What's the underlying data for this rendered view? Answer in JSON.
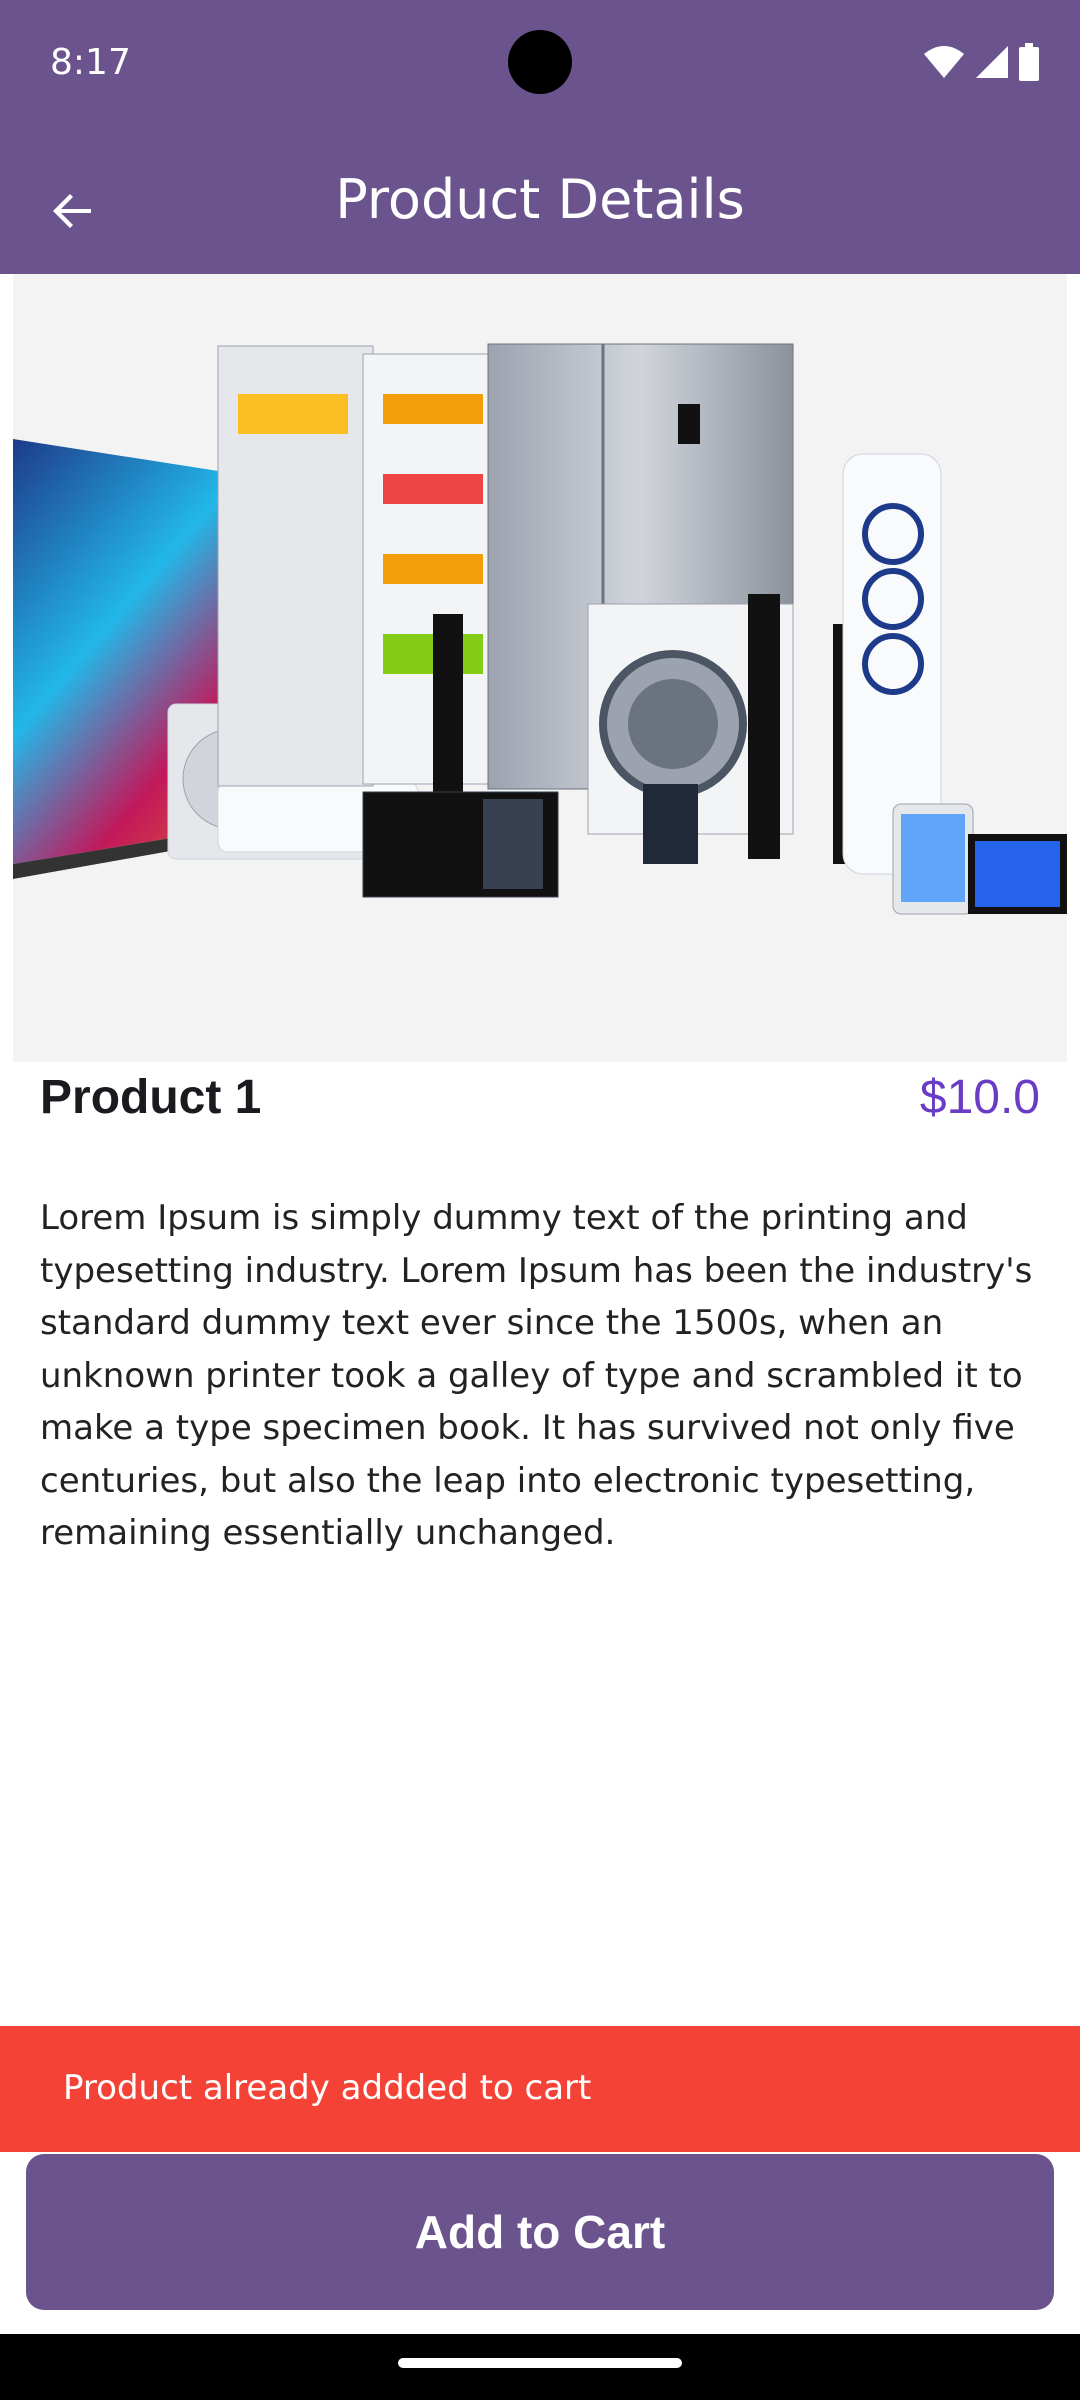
{
  "status_bar": {
    "time": "8:17",
    "icons": [
      "wifi-icon",
      "signal-icon",
      "battery-icon"
    ]
  },
  "app_bar": {
    "title": "Product Details",
    "back_icon": "arrow-back-icon"
  },
  "product": {
    "name": "Product 1",
    "price": "$10.0",
    "description": "Lorem Ipsum is simply dummy text of the printing and typesetting industry. Lorem Ipsum has been the industry's standard dummy text ever since the 1500s, when an unknown printer took a galley of type and scrambled it to make a type specimen book. It has survived not only five centuries, but also the leap into electronic typesetting, remaining essentially unchanged."
  },
  "snackbar": {
    "message": "Product already addded to cart"
  },
  "actions": {
    "add_to_cart_label": "Add to Cart"
  },
  "colors": {
    "primary": "#6b548e",
    "price": "#6a3bc4",
    "snackbar": "#f44336"
  }
}
